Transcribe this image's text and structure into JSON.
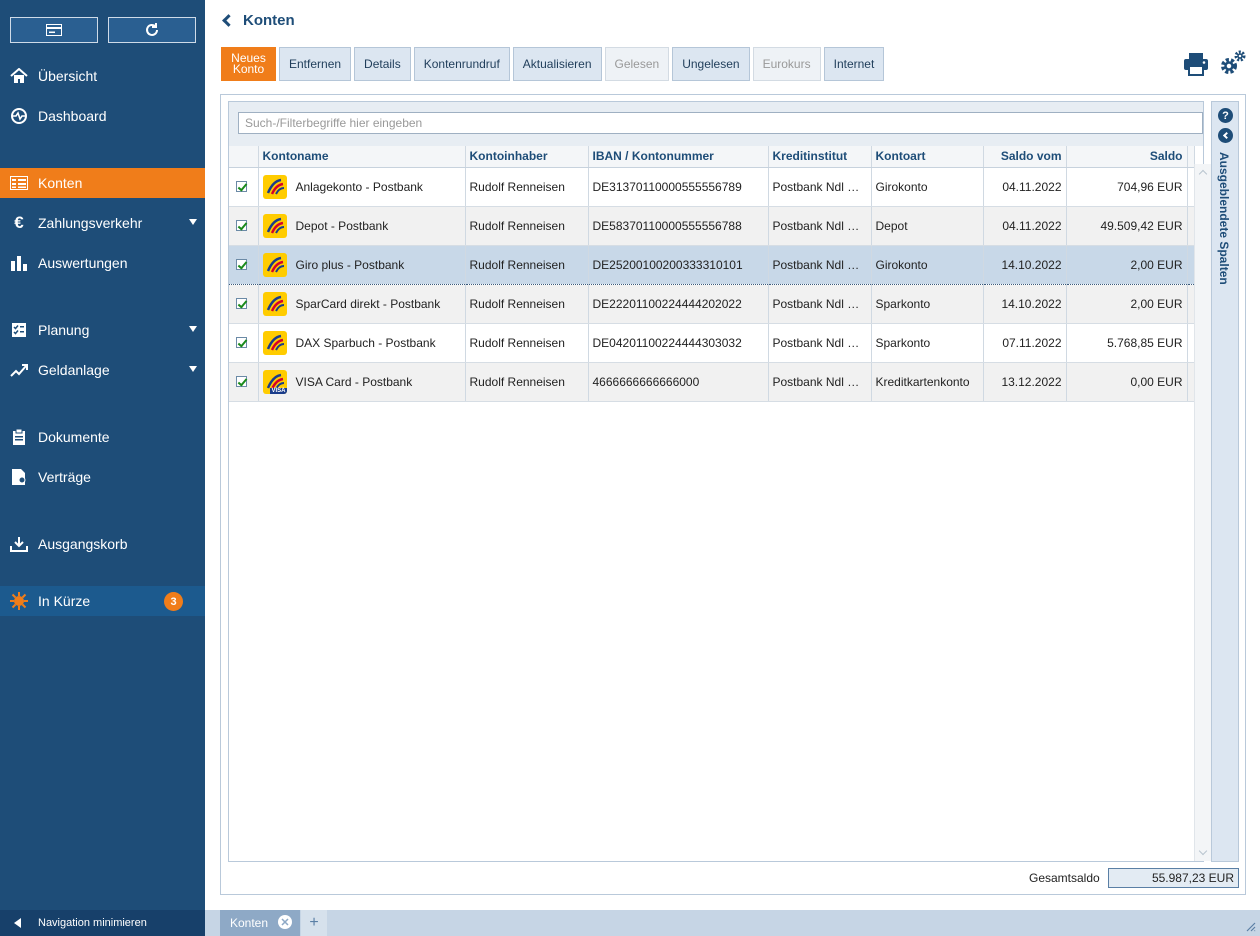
{
  "sidebar": {
    "items": [
      {
        "label": "Übersicht",
        "icon": "home-icon"
      },
      {
        "label": "Dashboard",
        "icon": "pulse-icon"
      },
      {
        "label": "Konten",
        "icon": "accounts-icon",
        "active": true
      },
      {
        "label": "Zahlungsverkehr",
        "icon": "euro-transfer-icon",
        "has_submenu": true
      },
      {
        "label": "Auswertungen",
        "icon": "bar-chart-icon"
      },
      {
        "label": "Planung",
        "icon": "checklist-icon",
        "has_submenu": true
      },
      {
        "label": "Geldanlage",
        "icon": "trend-icon",
        "has_submenu": true
      },
      {
        "label": "Dokumente",
        "icon": "document-icon"
      },
      {
        "label": "Verträge",
        "icon": "contract-icon"
      },
      {
        "label": "Ausgangskorb",
        "icon": "outbox-icon"
      },
      {
        "label": "In Kürze",
        "icon": "burst-icon",
        "badge": "3"
      }
    ],
    "minimize_label": "Navigation minimieren"
  },
  "header": {
    "title": "Konten"
  },
  "toolbar": {
    "buttons": [
      {
        "label": "Neues Konto",
        "state": "primary"
      },
      {
        "label": "Entfernen",
        "state": "enabled"
      },
      {
        "label": "Details",
        "state": "enabled"
      },
      {
        "label": "Kontenrundruf",
        "state": "enabled"
      },
      {
        "label": "Aktualisieren",
        "state": "enabled"
      },
      {
        "label": "Gelesen",
        "state": "disabled"
      },
      {
        "label": "Ungelesen",
        "state": "enabled"
      },
      {
        "label": "Eurokurs",
        "state": "disabled"
      },
      {
        "label": "Internet",
        "state": "enabled"
      }
    ]
  },
  "search": {
    "placeholder": "Such-/Filterbegriffe hier eingeben"
  },
  "table": {
    "columns": [
      "",
      "Kontoname",
      "Kontoinhaber",
      "IBAN / Kontonummer",
      "Kreditinstitut",
      "Kontoart",
      "Saldo vom",
      "Saldo"
    ],
    "rows": [
      {
        "checked": true,
        "name": "Anlagekonto - Postbank",
        "owner": "Rudolf Renneisen",
        "iban": "DE31370110000555556789",
        "bank": "Postbank Ndl Deutsche Bank",
        "type": "Girokonto",
        "date": "04.11.2022",
        "balance": "704,96 EUR"
      },
      {
        "checked": true,
        "name": "Depot - Postbank",
        "owner": "Rudolf Renneisen",
        "iban": "DE58370110000555556788",
        "bank": "Postbank Ndl Deutsche Bank",
        "type": "Depot",
        "date": "04.11.2022",
        "balance": "49.509,42 EUR"
      },
      {
        "checked": true,
        "name": "Giro plus - Postbank",
        "owner": "Rudolf Renneisen",
        "iban": "DE25200100200333310101",
        "bank": "Postbank Ndl Deutsche Bank",
        "type": "Girokonto",
        "date": "14.10.2022",
        "balance": "2,00 EUR",
        "selected": true
      },
      {
        "checked": true,
        "name": "SparCard direkt - Postbank",
        "owner": "Rudolf Renneisen",
        "iban": "DE22201100224444202022",
        "bank": "Postbank Ndl Deutsche Bank",
        "type": "Sparkonto",
        "date": "14.10.2022",
        "balance": "2,00 EUR"
      },
      {
        "checked": true,
        "name": "DAX Sparbuch - Postbank",
        "owner": "Rudolf Renneisen",
        "iban": "DE04201100224444303032",
        "bank": "Postbank Ndl Deutsche Bank",
        "type": "Sparkonto",
        "date": "07.11.2022",
        "balance": "5.768,85 EUR"
      },
      {
        "checked": true,
        "name": "VISA Card - Postbank",
        "owner": "Rudolf Renneisen",
        "iban": "4666666666666000",
        "bank": "Postbank Ndl Deutsche Bank",
        "type": "Kreditkartenkonto",
        "date": "13.12.2022",
        "balance": "0,00 EUR",
        "visa": true
      }
    ]
  },
  "side_panel": {
    "help_glyph": "?",
    "label": "Ausgeblendete Spalten"
  },
  "totals": {
    "label": "Gesamtsaldo",
    "value": "55.987,23 EUR"
  },
  "tabs": [
    {
      "label": "Konten"
    }
  ],
  "colors": {
    "sidebar": "#1e4d78",
    "accent": "#f07d1a",
    "selected_row": "#c8d8e8"
  }
}
